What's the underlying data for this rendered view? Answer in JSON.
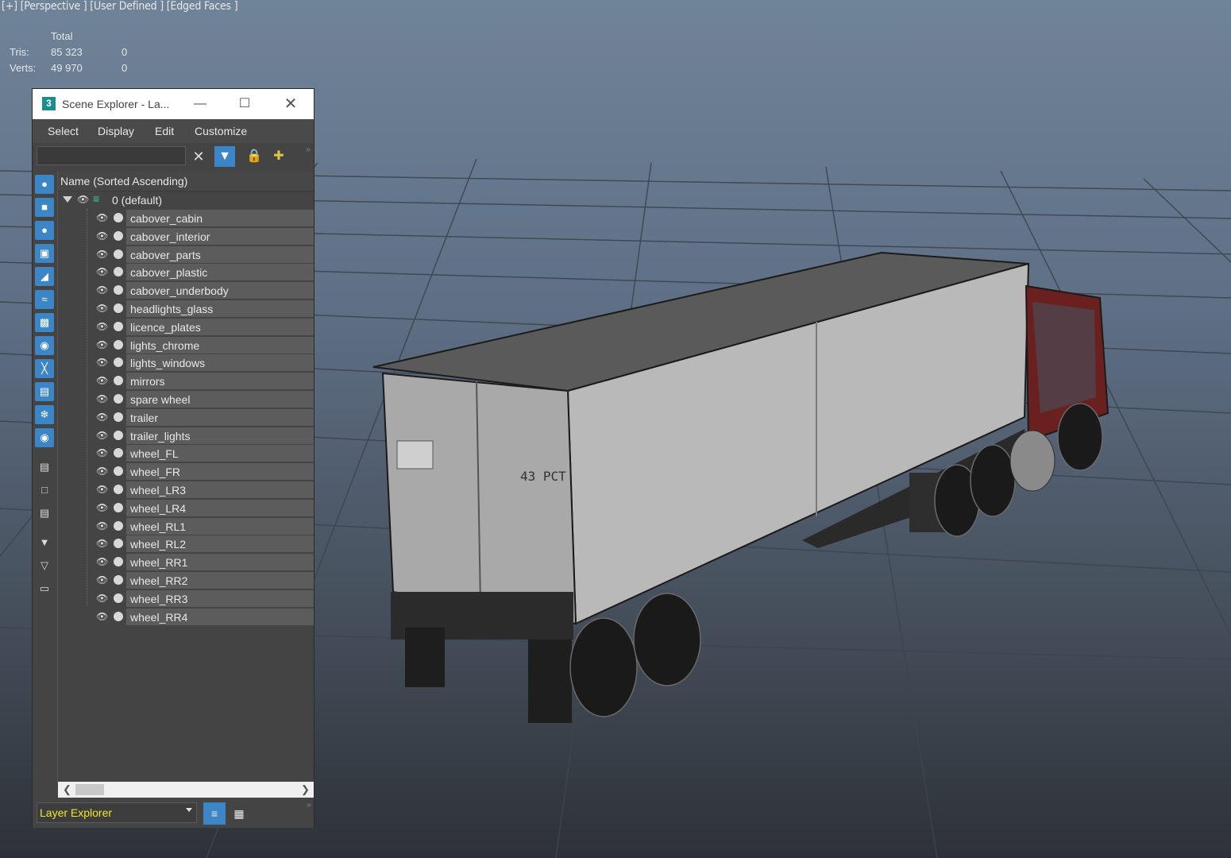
{
  "viewport": {
    "label": "[+] [Perspective ] [User Defined ] [Edged Faces ]",
    "stats": {
      "header": "Total",
      "tris_label": "Tris:",
      "tris_total": "85 323",
      "tris_selected": "0",
      "verts_label": "Verts:",
      "verts_total": "49 970",
      "verts_selected": "0"
    },
    "trailer_marking": "43 PCT"
  },
  "scene_explorer": {
    "app_icon": "3",
    "title": "Scene Explorer - La...",
    "menu": [
      "Select",
      "Display",
      "Edit",
      "Customize"
    ],
    "search_value": "",
    "column_header": "Name (Sorted Ascending)",
    "root_layer": "0 (default)",
    "objects": [
      "cabover_cabin",
      "cabover_interior",
      "cabover_parts",
      "cabover_plastic",
      "cabover_underbody",
      "headlights_glass",
      "licence_plates",
      "lights_chrome",
      "lights_windows",
      "mirrors",
      "spare wheel",
      "trailer",
      "trailer_lights",
      "wheel_FL",
      "wheel_FR",
      "wheel_LR3",
      "wheel_LR4",
      "wheel_RL1",
      "wheel_RL2",
      "wheel_RR1",
      "wheel_RR2",
      "wheel_RR3",
      "wheel_RR4"
    ],
    "explorer_selector": "Layer Explorer"
  },
  "colors": {
    "accent": "#3c86c8",
    "selector_text": "#f0e62b",
    "layer_icon": "#3fd1a0"
  }
}
